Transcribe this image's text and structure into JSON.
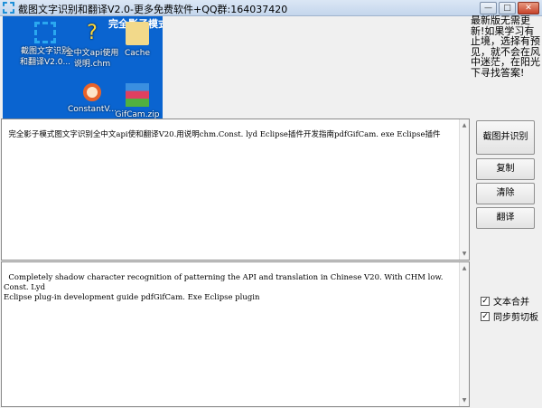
{
  "window": {
    "title": "截图文字识别和翻译V2.0-更多免费软件+QQ群:164037420",
    "minimize": "—",
    "maximize": "□",
    "close": "✕"
  },
  "screenshot": {
    "mode_label": "完全影子模式",
    "icons": [
      {
        "label": "截图文字识别和翻译V2.0...",
        "icon": "screenshot-icon"
      },
      {
        "label": "全中文api使用说明.chm",
        "icon": "help-doc-icon"
      },
      {
        "label": "Cache",
        "icon": "folder-icon"
      },
      {
        "label": "ConstantV...",
        "icon": "magnifier-icon"
      },
      {
        "label": "GifCam.zip",
        "icon": "archive-icon"
      }
    ]
  },
  "notice": "最新版无需更新!如果学习有止境，选择有预见，就不会在风中迷茫，在阳光下寻找答案!",
  "source_text": "完全影子模式图文字识别全中文api使和翻译V20.用说明chm.Const. lyd Eclipse插件开发指南pdfGifCam. exe Eclipse插件",
  "translated_text": "Completely shadow character recognition of patterning the API and translation in Chinese V20. With CHM low. Const. Lyd\nEclipse plug-in development guide pdfGifCam. Exe Eclipse plugin",
  "buttons": {
    "capture": "截图并识别",
    "copy": "复制",
    "clear": "清除",
    "translate": "翻译"
  },
  "options": [
    {
      "label": "文本合并",
      "checked": true
    },
    {
      "label": "同步剪切板",
      "checked": true
    }
  ],
  "scroll": {
    "up": "▲",
    "down": "▼"
  },
  "check_mark": "✓"
}
